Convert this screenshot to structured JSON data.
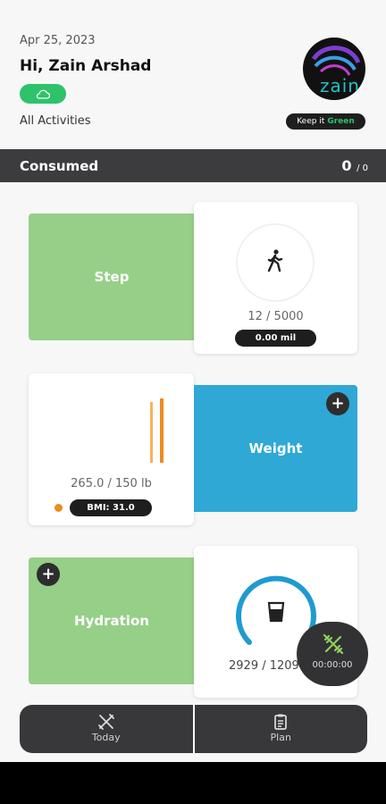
{
  "header": {
    "date": "Apr 25, 2023",
    "greeting": "Hi, Zain Arshad",
    "all_activities": "All Activities",
    "logo_text": "zain",
    "keep_prefix": "Keep it",
    "keep_green": "Green"
  },
  "consumed": {
    "label": "Consumed",
    "value": "0",
    "total": "/ 0"
  },
  "step": {
    "label": "Step",
    "count": "12 / 5000",
    "distance": "0.00 mil"
  },
  "weight": {
    "label": "Weight",
    "value": "265.0 / 150 lb",
    "bmi": "BMI: 31.0",
    "add": "+"
  },
  "hydration": {
    "label": "Hydration",
    "value": "2929 / 1209",
    "add": "+"
  },
  "timer": {
    "value": "00:00:00"
  },
  "nav": {
    "today": "Today",
    "plan": "Plan"
  },
  "colors": {
    "green_tile": "#96cf88",
    "blue_tile": "#2fa8d6",
    "dark": "#3c3c3e",
    "accent_green": "#2ec26a",
    "orange": "#f08b1e"
  },
  "icons": {
    "cloud": "cloud-icon",
    "walk": "walking-person-icon",
    "cup": "water-cup-icon",
    "dumbbell": "dumbbell-icon",
    "fork_knife": "fork-knife-icon",
    "plan": "clipboard-icon"
  }
}
